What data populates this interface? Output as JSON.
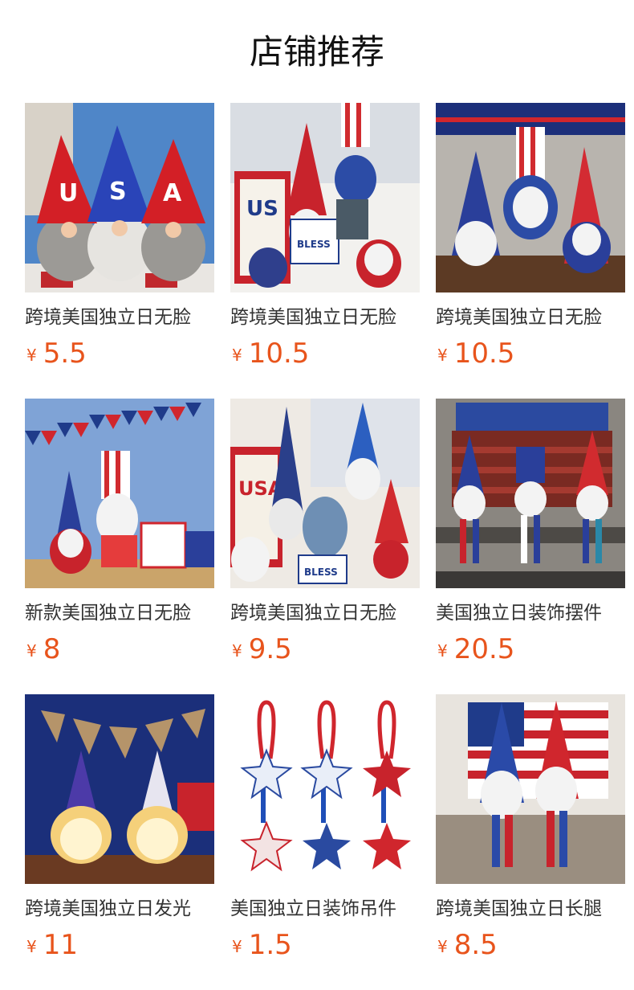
{
  "page": {
    "title": "店铺推荐"
  },
  "currency": "¥",
  "colors": {
    "price": "#e8541c",
    "text": "#333333"
  },
  "products": [
    {
      "name": "跨境美国独立日无脸",
      "price": "5.5",
      "image": "usa-gnome-trio-photo"
    },
    {
      "name": "跨境美国独立日无脸",
      "price": "10.5",
      "image": "patriotic-gnome-set-photo"
    },
    {
      "name": "跨境美国独立日无脸",
      "price": "10.5",
      "image": "star-hat-gnomes-photo"
    },
    {
      "name": "新款美国独立日无脸",
      "price": "8",
      "image": "gnomes-with-gifts-photo"
    },
    {
      "name": "跨境美国独立日无脸",
      "price": "9.5",
      "image": "liberty-gnome-set-photo"
    },
    {
      "name": "美国独立日装饰摆件",
      "price": "20.5",
      "image": "long-leg-gnomes-bench-photo"
    },
    {
      "name": "跨境美国独立日发光",
      "price": "11",
      "image": "glowing-gnomes-photo"
    },
    {
      "name": "美国独立日装饰吊件",
      "price": "1.5",
      "image": "star-hanging-ornaments-photo"
    },
    {
      "name": "跨境美国独立日长腿",
      "price": "8.5",
      "image": "long-leg-gnome-pair-photo"
    }
  ]
}
